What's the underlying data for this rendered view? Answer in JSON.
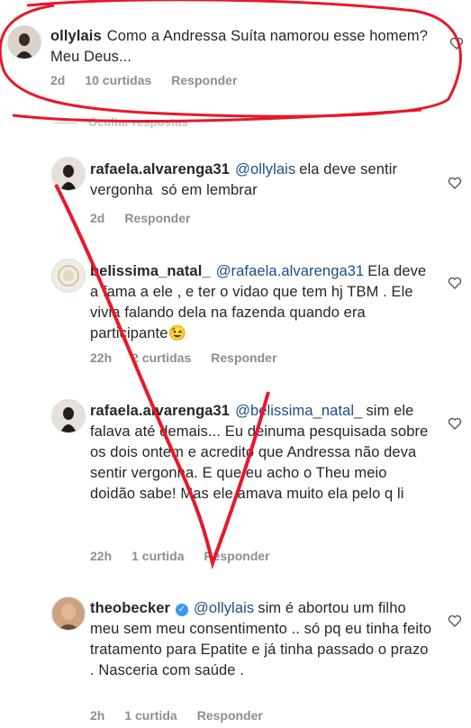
{
  "comments": [
    {
      "username": "ollylais",
      "text": "Como a Andressa Suíta namorou esse homem? Meu Deus...",
      "time": "2d",
      "likes": "10 curtidas",
      "reply": "Responder"
    },
    {
      "username": "rafaela.alvarenga31",
      "mention": "@ollylais",
      "text": "ela deve sentir vergonha  só em lembrar",
      "time": "2d",
      "reply": "Responder"
    },
    {
      "username": "belissima_natal_",
      "mention": "@rafaela.alvarenga31",
      "text": "Ela deve a fama a ele , e ter o vidao que tem hj TBM . Ele vivia falando dela na fazenda quando era participante😉",
      "time": "22h",
      "likes": "2 curtidas",
      "reply": "Responder"
    },
    {
      "username": "rafaela.alvarenga31",
      "mention": "@belissima_natal_",
      "text": "sim ele falava até demais... Eu deinuma pesquisada sobre os dois ontem e acredito que Andressa não deva sentir vergonha. E que eu acho o Theu meio doidão sabe! Mas ele amava muito ela pelo q li",
      "time": "22h",
      "likes": "1 curtida",
      "reply": "Responder"
    },
    {
      "username": "theobecker",
      "mention": "@ollylais",
      "text": "sim é abortou um filho meu sem meu consentimento .. só pq eu tinha feito tratamento para Epatite e já tinha passado o prazo . Nasceria com saúde .",
      "time": "2h",
      "likes": "1 curtida",
      "reply": "Responder"
    }
  ],
  "hide_replies": "Ocultar respostas",
  "annotation_color": "#e8182a"
}
